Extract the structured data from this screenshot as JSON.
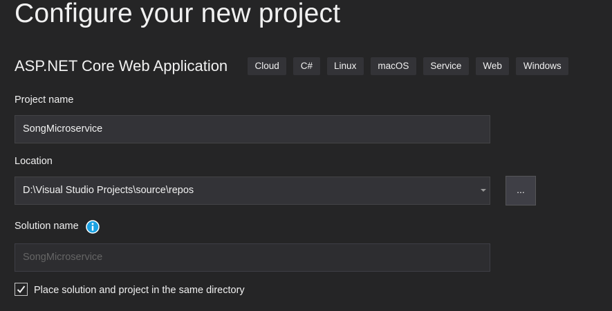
{
  "header": {
    "title": "Configure your new project"
  },
  "template": {
    "name": "ASP.NET Core Web Application",
    "tags": [
      "Cloud",
      "C#",
      "Linux",
      "macOS",
      "Service",
      "Web",
      "Windows"
    ]
  },
  "project_name": {
    "label": "Project name",
    "value": "SongMicroservice"
  },
  "location": {
    "label": "Location",
    "value": "D:\\Visual Studio Projects\\source\\repos",
    "browse_label": "..."
  },
  "solution_name": {
    "label": "Solution name",
    "value": "SongMicroservice",
    "info_icon": "info-icon"
  },
  "same_directory": {
    "label": "Place solution and project in the same directory",
    "checked": true
  },
  "colors": {
    "background": "#252526",
    "field_background": "#333337",
    "info_accent": "#1ba1e2"
  }
}
